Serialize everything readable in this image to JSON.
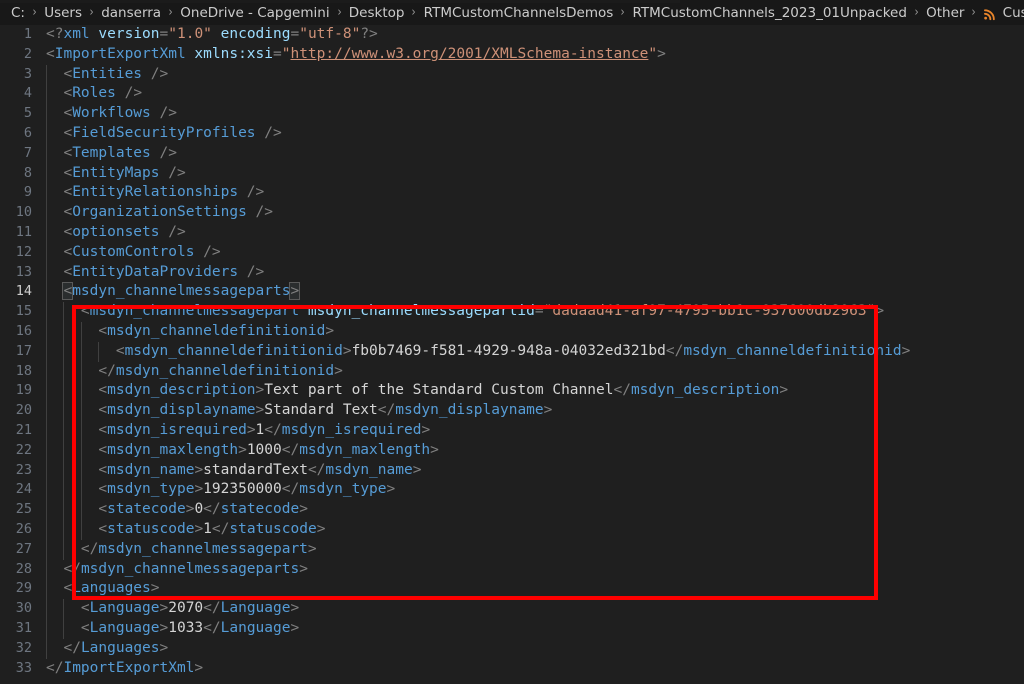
{
  "breadcrumb": {
    "separator": "›",
    "file_icon": "xml-file-icon",
    "items": [
      "C:",
      "Users",
      "danserra",
      "OneDrive - Capgemini",
      "Desktop",
      "RTMCustomChannelsDemos",
      "RTMCustomChannels_2023_01Unpacked",
      "Other",
      "Customizations.xml"
    ]
  },
  "annotation": {
    "color": "#fe0000",
    "type": "rectangle-highlight",
    "covers_lines": "14-28"
  },
  "editor": {
    "active_line": 14,
    "total_lines": 33,
    "language": "xml",
    "colors": {
      "background": "#1f1f1f",
      "gutter_text": "#6e7681",
      "tag": "#569cd6",
      "attribute": "#9cdcfe",
      "string": "#ce9178",
      "text": "#d4d4d4",
      "punctuation": "#808080"
    },
    "lines": [
      {
        "n": 1,
        "indent": 0,
        "tokens": [
          {
            "c": "punct",
            "t": "<?"
          },
          {
            "c": "tag",
            "t": "xml"
          },
          {
            "c": "text",
            "t": " "
          },
          {
            "c": "attr",
            "t": "version"
          },
          {
            "c": "punct",
            "t": "="
          },
          {
            "c": "str",
            "t": "\"1.0\""
          },
          {
            "c": "text",
            "t": " "
          },
          {
            "c": "attr",
            "t": "encoding"
          },
          {
            "c": "punct",
            "t": "="
          },
          {
            "c": "str",
            "t": "\"utf-8\""
          },
          {
            "c": "punct",
            "t": "?>"
          }
        ]
      },
      {
        "n": 2,
        "indent": 0,
        "tokens": [
          {
            "c": "punct",
            "t": "<"
          },
          {
            "c": "tag",
            "t": "ImportExportXml"
          },
          {
            "c": "text",
            "t": " "
          },
          {
            "c": "attr",
            "t": "xmlns:xsi"
          },
          {
            "c": "punct",
            "t": "="
          },
          {
            "c": "str",
            "t": "\""
          },
          {
            "c": "link",
            "t": "http://www.w3.org/2001/XMLSchema-instance"
          },
          {
            "c": "str",
            "t": "\""
          },
          {
            "c": "punct",
            "t": ">"
          }
        ]
      },
      {
        "n": 3,
        "indent": 1,
        "tokens": [
          {
            "c": "punct",
            "t": "<"
          },
          {
            "c": "tag",
            "t": "Entities"
          },
          {
            "c": "punct",
            "t": " />"
          }
        ]
      },
      {
        "n": 4,
        "indent": 1,
        "tokens": [
          {
            "c": "punct",
            "t": "<"
          },
          {
            "c": "tag",
            "t": "Roles"
          },
          {
            "c": "punct",
            "t": " />"
          }
        ]
      },
      {
        "n": 5,
        "indent": 1,
        "tokens": [
          {
            "c": "punct",
            "t": "<"
          },
          {
            "c": "tag",
            "t": "Workflows"
          },
          {
            "c": "punct",
            "t": " />"
          }
        ]
      },
      {
        "n": 6,
        "indent": 1,
        "tokens": [
          {
            "c": "punct",
            "t": "<"
          },
          {
            "c": "tag",
            "t": "FieldSecurityProfiles"
          },
          {
            "c": "punct",
            "t": " />"
          }
        ]
      },
      {
        "n": 7,
        "indent": 1,
        "tokens": [
          {
            "c": "punct",
            "t": "<"
          },
          {
            "c": "tag",
            "t": "Templates"
          },
          {
            "c": "punct",
            "t": " />"
          }
        ]
      },
      {
        "n": 8,
        "indent": 1,
        "tokens": [
          {
            "c": "punct",
            "t": "<"
          },
          {
            "c": "tag",
            "t": "EntityMaps"
          },
          {
            "c": "punct",
            "t": " />"
          }
        ]
      },
      {
        "n": 9,
        "indent": 1,
        "tokens": [
          {
            "c": "punct",
            "t": "<"
          },
          {
            "c": "tag",
            "t": "EntityRelationships"
          },
          {
            "c": "punct",
            "t": " />"
          }
        ]
      },
      {
        "n": 10,
        "indent": 1,
        "tokens": [
          {
            "c": "punct",
            "t": "<"
          },
          {
            "c": "tag",
            "t": "OrganizationSettings"
          },
          {
            "c": "punct",
            "t": " />"
          }
        ]
      },
      {
        "n": 11,
        "indent": 1,
        "tokens": [
          {
            "c": "punct",
            "t": "<"
          },
          {
            "c": "tag",
            "t": "optionsets"
          },
          {
            "c": "punct",
            "t": " />"
          }
        ]
      },
      {
        "n": 12,
        "indent": 1,
        "tokens": [
          {
            "c": "punct",
            "t": "<"
          },
          {
            "c": "tag",
            "t": "CustomControls"
          },
          {
            "c": "punct",
            "t": " />"
          }
        ]
      },
      {
        "n": 13,
        "indent": 1,
        "tokens": [
          {
            "c": "punct",
            "t": "<"
          },
          {
            "c": "tag",
            "t": "EntityDataProviders"
          },
          {
            "c": "punct",
            "t": " />"
          }
        ]
      },
      {
        "n": 14,
        "indent": 1,
        "active": true,
        "tokens": [
          {
            "c": "punct",
            "t": "<",
            "m": true
          },
          {
            "c": "tag",
            "t": "msdyn_channelmessageparts"
          },
          {
            "c": "punct",
            "t": ">",
            "m": true
          }
        ]
      },
      {
        "n": 15,
        "indent": 2,
        "tokens": [
          {
            "c": "punct",
            "t": "<"
          },
          {
            "c": "tag",
            "t": "msdyn_channelmessagepart"
          },
          {
            "c": "text",
            "t": " "
          },
          {
            "c": "attr",
            "t": "msdyn_channelmessagepartid"
          },
          {
            "c": "punct",
            "t": "="
          },
          {
            "c": "str",
            "t": "\"dadaad41-af97-4795-bb1c-937600db2963\""
          },
          {
            "c": "punct",
            "t": ">"
          }
        ]
      },
      {
        "n": 16,
        "indent": 3,
        "tokens": [
          {
            "c": "punct",
            "t": "<"
          },
          {
            "c": "tag",
            "t": "msdyn_channeldefinitionid"
          },
          {
            "c": "punct",
            "t": ">"
          }
        ]
      },
      {
        "n": 17,
        "indent": 4,
        "tokens": [
          {
            "c": "punct",
            "t": "<"
          },
          {
            "c": "tag",
            "t": "msdyn_channeldefinitionid"
          },
          {
            "c": "punct",
            "t": ">"
          },
          {
            "c": "text",
            "t": "fb0b7469-f581-4929-948a-04032ed321bd"
          },
          {
            "c": "punct",
            "t": "</"
          },
          {
            "c": "tag",
            "t": "msdyn_channeldefinitionid"
          },
          {
            "c": "punct",
            "t": ">"
          }
        ]
      },
      {
        "n": 18,
        "indent": 3,
        "tokens": [
          {
            "c": "punct",
            "t": "</"
          },
          {
            "c": "tag",
            "t": "msdyn_channeldefinitionid"
          },
          {
            "c": "punct",
            "t": ">"
          }
        ]
      },
      {
        "n": 19,
        "indent": 3,
        "tokens": [
          {
            "c": "punct",
            "t": "<"
          },
          {
            "c": "tag",
            "t": "msdyn_description"
          },
          {
            "c": "punct",
            "t": ">"
          },
          {
            "c": "text",
            "t": "Text part of the Standard Custom Channel"
          },
          {
            "c": "punct",
            "t": "</"
          },
          {
            "c": "tag",
            "t": "msdyn_description"
          },
          {
            "c": "punct",
            "t": ">"
          }
        ]
      },
      {
        "n": 20,
        "indent": 3,
        "tokens": [
          {
            "c": "punct",
            "t": "<"
          },
          {
            "c": "tag",
            "t": "msdyn_displayname"
          },
          {
            "c": "punct",
            "t": ">"
          },
          {
            "c": "text",
            "t": "Standard Text"
          },
          {
            "c": "punct",
            "t": "</"
          },
          {
            "c": "tag",
            "t": "msdyn_displayname"
          },
          {
            "c": "punct",
            "t": ">"
          }
        ]
      },
      {
        "n": 21,
        "indent": 3,
        "tokens": [
          {
            "c": "punct",
            "t": "<"
          },
          {
            "c": "tag",
            "t": "msdyn_isrequired"
          },
          {
            "c": "punct",
            "t": ">"
          },
          {
            "c": "text",
            "t": "1"
          },
          {
            "c": "punct",
            "t": "</"
          },
          {
            "c": "tag",
            "t": "msdyn_isrequired"
          },
          {
            "c": "punct",
            "t": ">"
          }
        ]
      },
      {
        "n": 22,
        "indent": 3,
        "tokens": [
          {
            "c": "punct",
            "t": "<"
          },
          {
            "c": "tag",
            "t": "msdyn_maxlength"
          },
          {
            "c": "punct",
            "t": ">"
          },
          {
            "c": "text",
            "t": "1000"
          },
          {
            "c": "punct",
            "t": "</"
          },
          {
            "c": "tag",
            "t": "msdyn_maxlength"
          },
          {
            "c": "punct",
            "t": ">"
          }
        ]
      },
      {
        "n": 23,
        "indent": 3,
        "tokens": [
          {
            "c": "punct",
            "t": "<"
          },
          {
            "c": "tag",
            "t": "msdyn_name"
          },
          {
            "c": "punct",
            "t": ">"
          },
          {
            "c": "text",
            "t": "standardText"
          },
          {
            "c": "punct",
            "t": "</"
          },
          {
            "c": "tag",
            "t": "msdyn_name"
          },
          {
            "c": "punct",
            "t": ">"
          }
        ]
      },
      {
        "n": 24,
        "indent": 3,
        "tokens": [
          {
            "c": "punct",
            "t": "<"
          },
          {
            "c": "tag",
            "t": "msdyn_type"
          },
          {
            "c": "punct",
            "t": ">"
          },
          {
            "c": "text",
            "t": "192350000"
          },
          {
            "c": "punct",
            "t": "</"
          },
          {
            "c": "tag",
            "t": "msdyn_type"
          },
          {
            "c": "punct",
            "t": ">"
          }
        ]
      },
      {
        "n": 25,
        "indent": 3,
        "tokens": [
          {
            "c": "punct",
            "t": "<"
          },
          {
            "c": "tag",
            "t": "statecode"
          },
          {
            "c": "punct",
            "t": ">"
          },
          {
            "c": "text",
            "t": "0"
          },
          {
            "c": "punct",
            "t": "</"
          },
          {
            "c": "tag",
            "t": "statecode"
          },
          {
            "c": "punct",
            "t": ">"
          }
        ]
      },
      {
        "n": 26,
        "indent": 3,
        "tokens": [
          {
            "c": "punct",
            "t": "<"
          },
          {
            "c": "tag",
            "t": "statuscode"
          },
          {
            "c": "punct",
            "t": ">"
          },
          {
            "c": "text",
            "t": "1"
          },
          {
            "c": "punct",
            "t": "</"
          },
          {
            "c": "tag",
            "t": "statuscode"
          },
          {
            "c": "punct",
            "t": ">"
          }
        ]
      },
      {
        "n": 27,
        "indent": 2,
        "tokens": [
          {
            "c": "punct",
            "t": "</"
          },
          {
            "c": "tag",
            "t": "msdyn_channelmessagepart"
          },
          {
            "c": "punct",
            "t": ">"
          }
        ]
      },
      {
        "n": 28,
        "indent": 1,
        "tokens": [
          {
            "c": "punct",
            "t": "</"
          },
          {
            "c": "tag",
            "t": "msdyn_channelmessageparts"
          },
          {
            "c": "punct",
            "t": ">"
          }
        ]
      },
      {
        "n": 29,
        "indent": 1,
        "tokens": [
          {
            "c": "punct",
            "t": "<"
          },
          {
            "c": "tag",
            "t": "Languages"
          },
          {
            "c": "punct",
            "t": ">"
          }
        ]
      },
      {
        "n": 30,
        "indent": 2,
        "tokens": [
          {
            "c": "punct",
            "t": "<"
          },
          {
            "c": "tag",
            "t": "Language"
          },
          {
            "c": "punct",
            "t": ">"
          },
          {
            "c": "text",
            "t": "2070"
          },
          {
            "c": "punct",
            "t": "</"
          },
          {
            "c": "tag",
            "t": "Language"
          },
          {
            "c": "punct",
            "t": ">"
          }
        ]
      },
      {
        "n": 31,
        "indent": 2,
        "tokens": [
          {
            "c": "punct",
            "t": "<"
          },
          {
            "c": "tag",
            "t": "Language"
          },
          {
            "c": "punct",
            "t": ">"
          },
          {
            "c": "text",
            "t": "1033"
          },
          {
            "c": "punct",
            "t": "</"
          },
          {
            "c": "tag",
            "t": "Language"
          },
          {
            "c": "punct",
            "t": ">"
          }
        ]
      },
      {
        "n": 32,
        "indent": 1,
        "tokens": [
          {
            "c": "punct",
            "t": "</"
          },
          {
            "c": "tag",
            "t": "Languages"
          },
          {
            "c": "punct",
            "t": ">"
          }
        ]
      },
      {
        "n": 33,
        "indent": 0,
        "tokens": [
          {
            "c": "punct",
            "t": "</"
          },
          {
            "c": "tag",
            "t": "ImportExportXml"
          },
          {
            "c": "punct",
            "t": ">"
          }
        ]
      }
    ]
  }
}
